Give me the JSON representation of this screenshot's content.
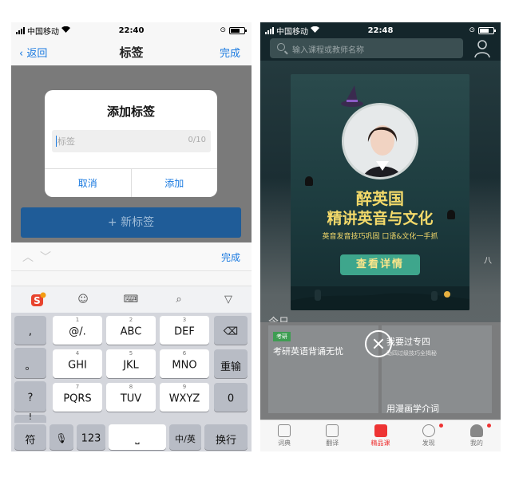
{
  "left": {
    "status": {
      "carrier": "中国移动",
      "time": "22:40"
    },
    "nav": {
      "back": "返回",
      "title": "标签",
      "done": "完成"
    },
    "add_tag_button": "+ 新标签",
    "dialog": {
      "title": "添加标签",
      "placeholder": "标签",
      "counter": "0/10",
      "cancel": "取消",
      "confirm": "添加"
    },
    "accessory": {
      "done": "完成"
    },
    "keyboard": {
      "rows": [
        [
          {
            "num": "",
            "label": ","
          },
          {
            "num": "1",
            "label": "@/."
          },
          {
            "num": "2",
            "label": "ABC"
          },
          {
            "num": "3",
            "label": "DEF"
          },
          {
            "num": "",
            "label": "⌫"
          }
        ],
        [
          {
            "num": "",
            "label": "。"
          },
          {
            "num": "4",
            "label": "GHI"
          },
          {
            "num": "5",
            "label": "JKL"
          },
          {
            "num": "6",
            "label": "MNO"
          },
          {
            "num": "",
            "label": "重输"
          }
        ],
        [
          {
            "num": "",
            "label": "?"
          },
          {
            "num": "7",
            "label": "PQRS"
          },
          {
            "num": "8",
            "label": "TUV"
          },
          {
            "num": "9",
            "label": "WXYZ"
          },
          {
            "num": "",
            "label": "0"
          }
        ],
        [
          {
            "num": "",
            "label": "!"
          }
        ]
      ],
      "bottom": {
        "symbol": "符",
        "mic": "🎤",
        "num": "123",
        "space": "␣",
        "lang": "中/英",
        "enter": "换行"
      }
    }
  },
  "right": {
    "status": {
      "carrier": "中国移动",
      "time": "22:48"
    },
    "search": {
      "placeholder": "输入课程或教师名称"
    },
    "popup": {
      "title1": "醉英国",
      "title2": "精讲英音与文化",
      "subtitle": "英音发音技巧巩固 口语&文化一手抓",
      "button": "查看详情"
    },
    "background": {
      "today": "今日",
      "eight": "八",
      "card1": {
        "tag": "考研",
        "title": "考研英语背诵无忧"
      },
      "card2": {
        "title": "我要过专四",
        "subtitle": "助四过级技巧全揭秘"
      },
      "card3": {
        "title": "用漫画学介词"
      }
    },
    "tabs": [
      {
        "label": "词典",
        "icon": "dictionary-icon",
        "active": false
      },
      {
        "label": "翻译",
        "icon": "translate-icon",
        "active": false
      },
      {
        "label": "精品课",
        "icon": "video-course-icon",
        "active": true
      },
      {
        "label": "发现",
        "icon": "compass-icon",
        "active": false
      },
      {
        "label": "我的",
        "icon": "profile-icon",
        "active": false
      }
    ],
    "colors": {
      "accent": "#e33333",
      "popup_gold": "#f3d96a",
      "popup_button": "#3ea68c"
    }
  }
}
